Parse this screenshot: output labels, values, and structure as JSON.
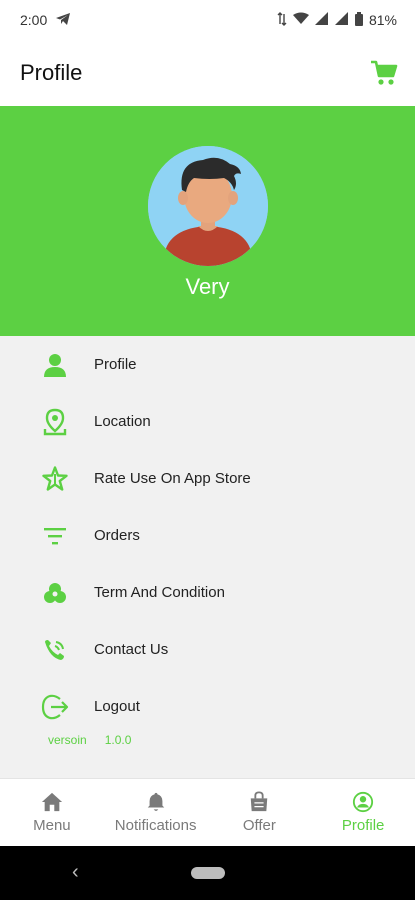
{
  "status_bar": {
    "time": "2:00",
    "battery": "81%"
  },
  "app_bar": {
    "title": "Profile",
    "cart_icon": "cart-icon"
  },
  "profile": {
    "name": "Very"
  },
  "menu": {
    "items": [
      {
        "label": "Profile",
        "icon": "person-icon"
      },
      {
        "label": "Location",
        "icon": "location-pin-icon"
      },
      {
        "label": "Rate Use On App Store",
        "icon": "star-icon"
      },
      {
        "label": "Orders",
        "icon": "filter-lines-icon"
      },
      {
        "label": "Term And Condition",
        "icon": "terms-icon"
      },
      {
        "label": "Contact Us",
        "icon": "contact-icon"
      },
      {
        "label": "Logout",
        "icon": "logout-icon"
      }
    ]
  },
  "version": {
    "label": "versoin",
    "value": "1.0.0"
  },
  "bottom_nav": {
    "items": [
      {
        "label": "Menu",
        "icon": "home-icon",
        "active": false
      },
      {
        "label": "Notifications",
        "icon": "bell-icon",
        "active": false
      },
      {
        "label": "Offer",
        "icon": "shopping-bag-icon",
        "active": false
      },
      {
        "label": "Profile",
        "icon": "profile-circle-icon",
        "active": true
      }
    ]
  },
  "colors": {
    "accent": "#5cd043",
    "background": "#f1f1f1",
    "avatar_bg": "#8fd3f4"
  }
}
